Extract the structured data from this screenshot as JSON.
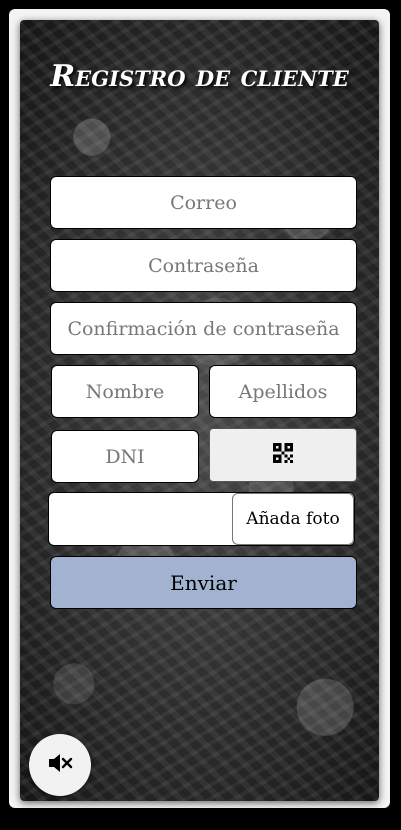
{
  "form": {
    "title": "Registro de cliente",
    "email_placeholder": "Correo",
    "password_placeholder": "Contraseña",
    "confirm_password_placeholder": "Confirmación de contraseña",
    "name_placeholder": "Nombre",
    "surname_placeholder": "Apellidos",
    "dni_placeholder": "DNI",
    "qr_icon": "qr-code-icon",
    "photo_button_label": "Añada foto",
    "submit_label": "Enviar"
  },
  "controls": {
    "sound_icon": "speaker-muted-icon"
  },
  "colors": {
    "submit_bg": "#a2b3d1",
    "background": "#000000"
  }
}
